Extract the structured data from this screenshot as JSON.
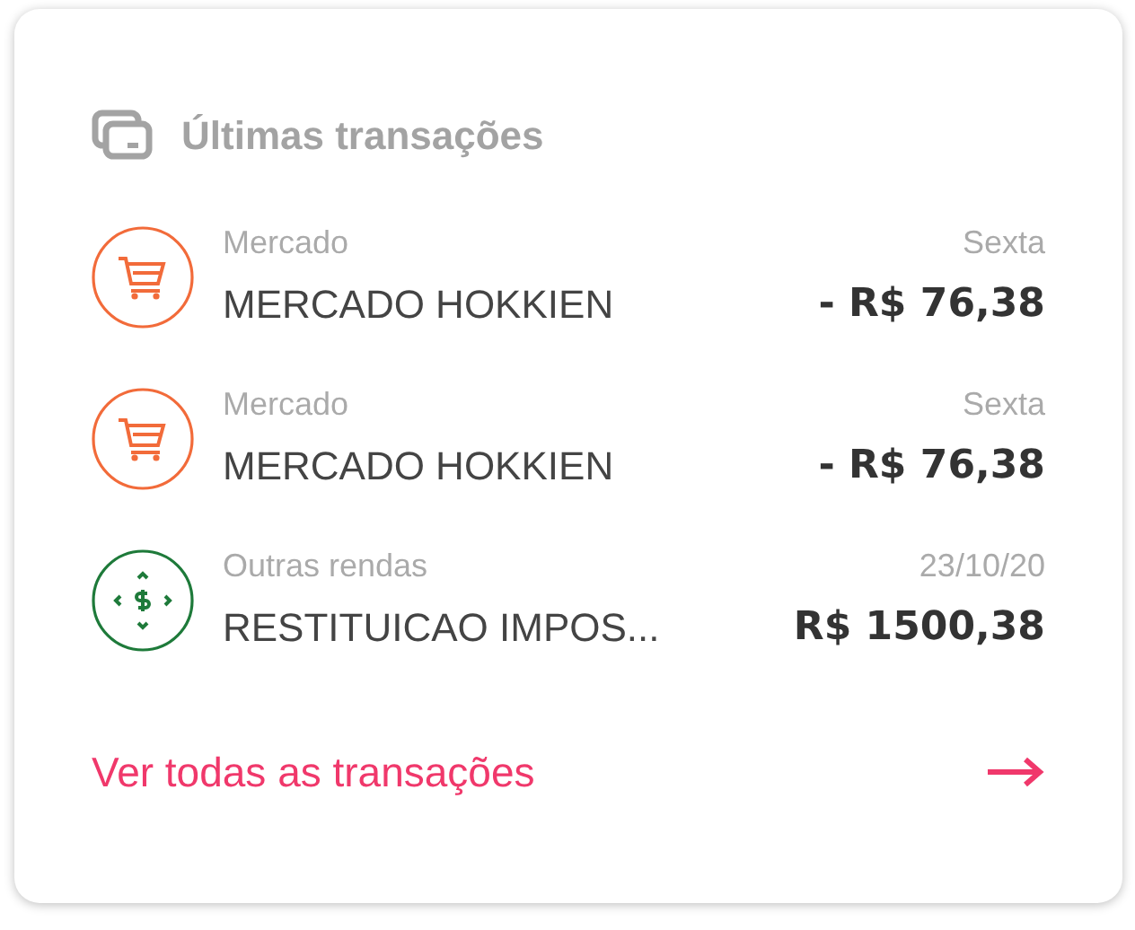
{
  "card": {
    "title": "Últimas transações",
    "transactions": [
      {
        "kind": "shopping",
        "color": "#f26b3a",
        "category": "Mercado",
        "description": "MERCADO HOKKIEN",
        "date": "Sexta",
        "amount": "- R$ 76,38"
      },
      {
        "kind": "shopping",
        "color": "#f26b3a",
        "category": "Mercado",
        "description": "MERCADO HOKKIEN",
        "date": "Sexta",
        "amount": "- R$ 76,38"
      },
      {
        "kind": "income",
        "color": "#1e7a3a",
        "category": "Outras rendas",
        "description": "RESTITUICAO IMPOS...",
        "date": "23/10/20",
        "amount": "R$ 1500,38"
      }
    ],
    "link": "Ver todas as transações"
  }
}
